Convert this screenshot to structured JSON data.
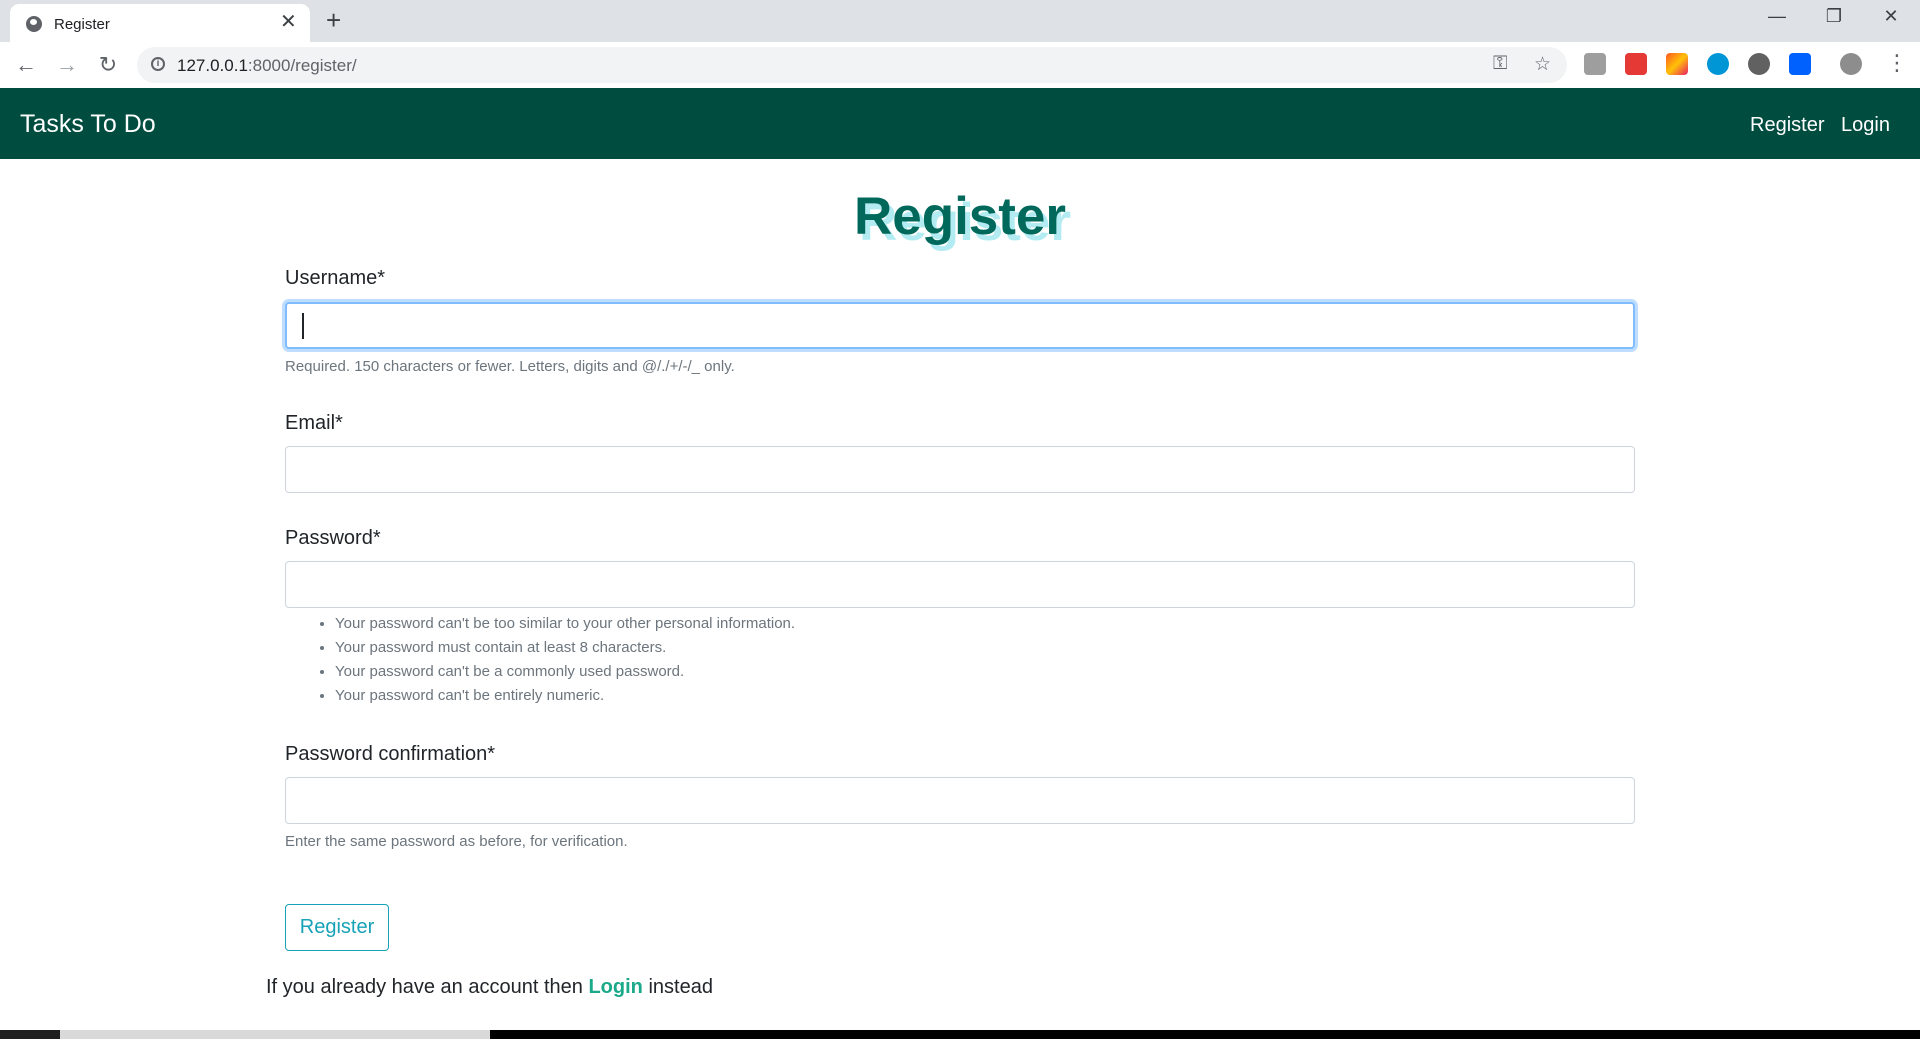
{
  "browser": {
    "tab_title": "Register",
    "url_host": "127.0.0.1",
    "url_rest": ":8000/register/"
  },
  "navbar": {
    "brand": "Tasks To Do",
    "links": [
      "Register",
      "Login"
    ]
  },
  "form": {
    "title": "Register",
    "fields": {
      "username": {
        "label": "Username*",
        "value": "",
        "help": "Required. 150 characters or fewer. Letters, digits and @/./+/-/_ only."
      },
      "email": {
        "label": "Email*",
        "value": ""
      },
      "password": {
        "label": "Password*",
        "value": "",
        "rules": [
          "Your password can't be too similar to your other personal information.",
          "Your password must contain at least 8 characters.",
          "Your password can't be a commonly used password.",
          "Your password can't be entirely numeric."
        ]
      },
      "password_confirmation": {
        "label": "Password confirmation*",
        "value": "",
        "help": "Enter the same password as before, for verification."
      }
    },
    "submit_label": "Register"
  },
  "footer": {
    "prefix": "If you already have an account then ",
    "link": "Login",
    "suffix": " instead"
  },
  "colors": {
    "navbar_bg": "#004d40",
    "title": "#00695c",
    "title_shadow": "#b2ebf2",
    "button": "#17a2b8",
    "link": "#1aaa8a"
  }
}
